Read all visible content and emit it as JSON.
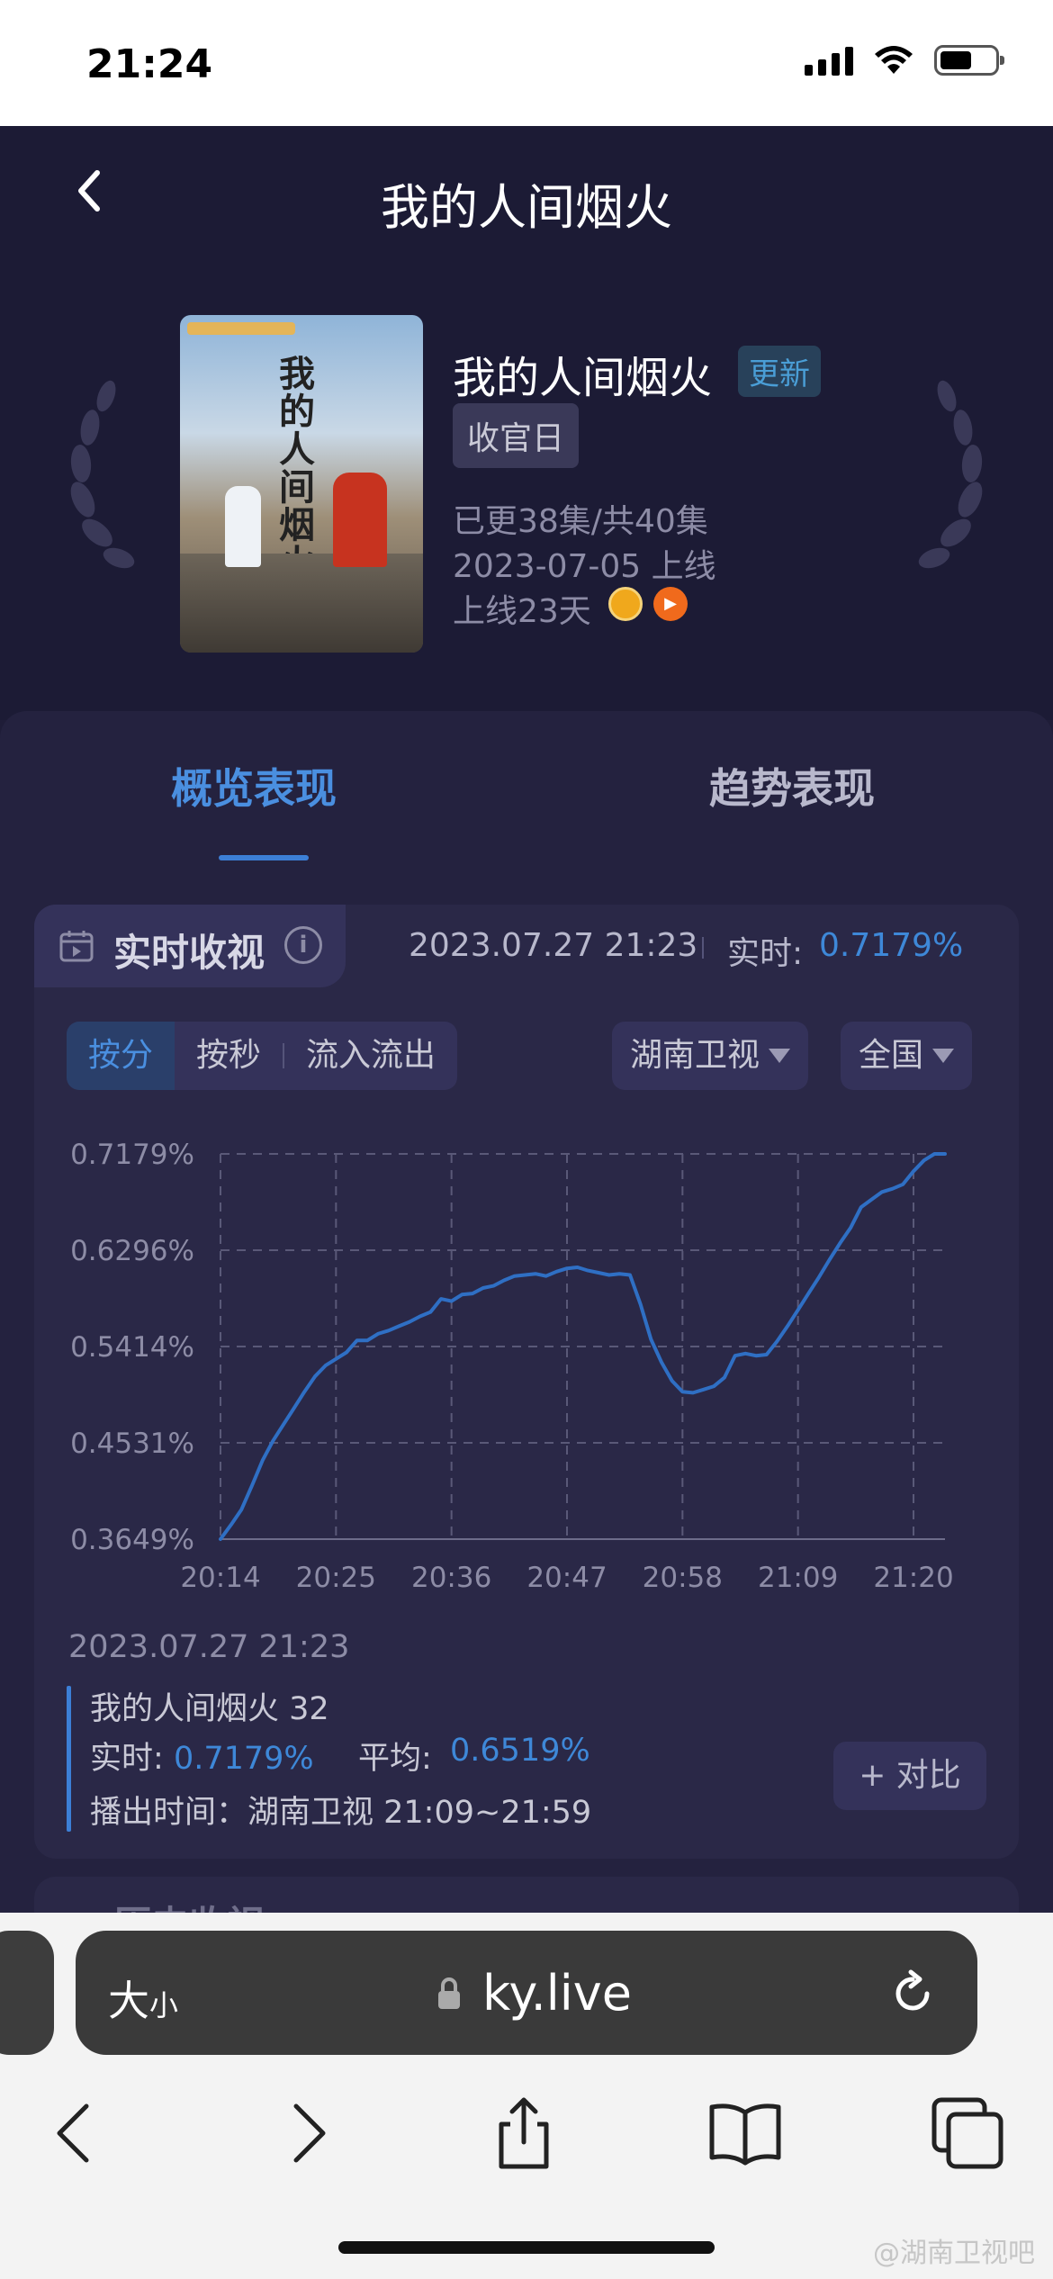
{
  "status_bar": {
    "time": "21:24"
  },
  "header": {
    "title": "我的人间烟火"
  },
  "show": {
    "name": "我的人间烟火",
    "update_badge": "更新",
    "tag": "收官日",
    "episodes": "已更38集/共40集",
    "release": "2023-07-05 上线",
    "days_online": "上线23天",
    "poster_title": "我的人间烟火",
    "platform_icons": [
      "hunan-tv-icon",
      "mgtv-icon"
    ]
  },
  "tabs": [
    {
      "label": "概览表现",
      "active": true
    },
    {
      "label": "趋势表现",
      "active": false
    }
  ],
  "realtime_card": {
    "title": "实时收视",
    "datetime": "2023.07.27 21:23",
    "realtime_label": "实时:",
    "realtime_value": "0.7179%",
    "segments": [
      "按分",
      "按秒",
      "流入流出"
    ],
    "active_segment": 0,
    "channel": "湖南卫视",
    "region": "全国",
    "tooltip": {
      "date": "2023.07.27 21:23",
      "program": "我的人间烟火 32",
      "realtime_label": "实时:",
      "realtime_value": "0.7179%",
      "avg_label": "平均:",
      "avg_value": "0.6519%",
      "airtime": "播出时间：湖南卫视 21:09~21:59"
    },
    "compare_label": "+ 对比"
  },
  "next_card": {
    "title": "历史收视"
  },
  "chart_data": {
    "type": "line",
    "x_ticks": [
      "20:14",
      "20:25",
      "20:36",
      "20:47",
      "20:58",
      "21:09",
      "21:20"
    ],
    "y_ticks": [
      "0.7179%",
      "0.6296%",
      "0.5414%",
      "0.4531%",
      "0.3649%"
    ],
    "ylim": [
      0.3649,
      0.7179
    ],
    "xlim_minutes": [
      0,
      69
    ],
    "x_minutes": [
      0,
      1,
      2,
      3,
      4,
      5,
      6,
      7,
      8,
      9,
      10,
      11,
      12,
      13,
      14,
      15,
      16,
      17,
      18,
      19,
      20,
      21,
      22,
      23,
      24,
      25,
      26,
      27,
      28,
      29,
      30,
      31,
      32,
      33,
      34,
      35,
      36,
      37,
      38,
      39,
      40,
      41,
      42,
      43,
      44,
      45,
      46,
      47,
      48,
      49,
      50,
      51,
      52,
      53,
      54,
      55,
      56,
      57,
      58,
      59,
      60,
      61,
      62,
      63,
      64,
      65,
      66,
      67,
      68,
      69
    ],
    "series": [
      {
        "color": "#2f6fc4",
        "values": [
          0.3649,
          0.378,
          0.392,
          0.414,
          0.437,
          0.455,
          0.47,
          0.485,
          0.5,
          0.514,
          0.524,
          0.53,
          0.536,
          0.547,
          0.547,
          0.553,
          0.556,
          0.56,
          0.564,
          0.569,
          0.573,
          0.585,
          0.583,
          0.589,
          0.59,
          0.595,
          0.597,
          0.602,
          0.606,
          0.607,
          0.608,
          0.606,
          0.61,
          0.613,
          0.614,
          0.611,
          0.609,
          0.607,
          0.608,
          0.607,
          0.58,
          0.548,
          0.527,
          0.51,
          0.5,
          0.499,
          0.502,
          0.505,
          0.513,
          0.533,
          0.535,
          0.533,
          0.534,
          0.546,
          0.56,
          0.575,
          0.59,
          0.605,
          0.621,
          0.636,
          0.65,
          0.669,
          0.676,
          0.683,
          0.686,
          0.69,
          0.702,
          0.712,
          0.7179,
          0.7179
        ]
      }
    ],
    "grid": true
  },
  "browser": {
    "text_size_label": "大",
    "text_size_small": "小",
    "url": "ky.live"
  },
  "watermark": "@湖南卫视吧"
}
